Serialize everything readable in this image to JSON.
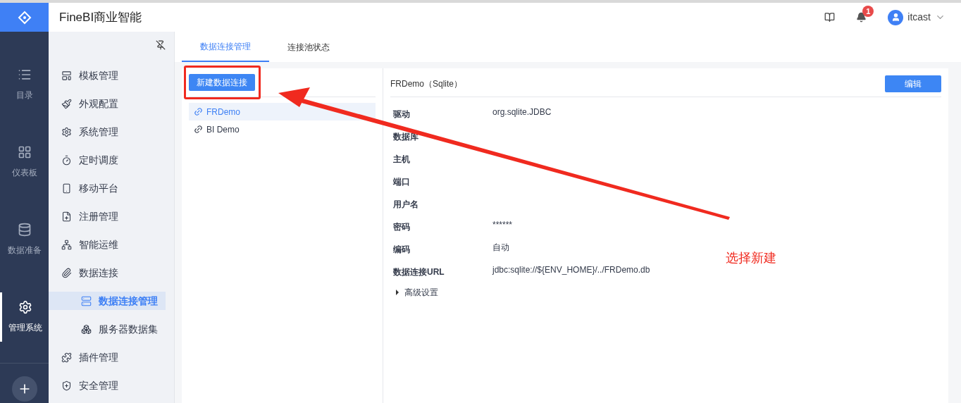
{
  "app": {
    "title": "FineBI商业智能"
  },
  "header": {
    "notification_count": "1",
    "user": "itcast"
  },
  "rail": [
    {
      "kind": "list",
      "label": "目录",
      "selected": false
    },
    {
      "kind": "grid",
      "label": "仪表板",
      "selected": false
    },
    {
      "kind": "db",
      "label": "数据准备",
      "selected": false
    },
    {
      "kind": "gear",
      "label": "管理系统",
      "selected": true
    }
  ],
  "menu": [
    {
      "kind": "template",
      "label": "模板管理",
      "selected": false
    },
    {
      "kind": "brush",
      "label": "外观配置",
      "selected": false
    },
    {
      "kind": "gear",
      "label": "系统管理",
      "selected": false
    },
    {
      "kind": "timer",
      "label": "定时调度",
      "selected": false
    },
    {
      "kind": "mobile",
      "label": "移动平台",
      "selected": false
    },
    {
      "kind": "register",
      "label": "注册管理",
      "selected": false
    },
    {
      "kind": "ops",
      "label": "智能运维",
      "selected": false
    },
    {
      "kind": "clip",
      "label": "数据连接",
      "selected": false,
      "children": [
        {
          "kind": "server",
          "label": "数据连接管理",
          "selected": true
        },
        {
          "kind": "dataset",
          "label": "服务器数据集",
          "selected": false
        }
      ]
    },
    {
      "kind": "plugin",
      "label": "插件管理",
      "selected": false
    },
    {
      "kind": "shield",
      "label": "安全管理",
      "selected": false
    }
  ],
  "tabs": [
    {
      "label": "数据连接管理",
      "selected": true
    },
    {
      "label": "连接池状态",
      "selected": false
    }
  ],
  "new_button": "新建数据连接",
  "connections": [
    {
      "name": "FRDemo",
      "selected": true
    },
    {
      "name": "BI Demo",
      "selected": false
    }
  ],
  "detail": {
    "title": "FRDemo（Sqlite）",
    "edit_button": "编辑",
    "fields": [
      {
        "label": "驱动",
        "value": "org.sqlite.JDBC"
      },
      {
        "label": "数据库"
      },
      {
        "label": "主机"
      },
      {
        "label": "端口"
      },
      {
        "label": "用户名"
      },
      {
        "label": "密码",
        "value": "******"
      },
      {
        "label": "编码",
        "value": "自动"
      },
      {
        "label": "数据连接URL",
        "value": "jdbc:sqlite://${ENV_HOME}/../FRDemo.db"
      }
    ],
    "advanced": {
      "label": "高级设置",
      "expanded": false
    }
  },
  "annotation": {
    "text": "选择新建"
  }
}
